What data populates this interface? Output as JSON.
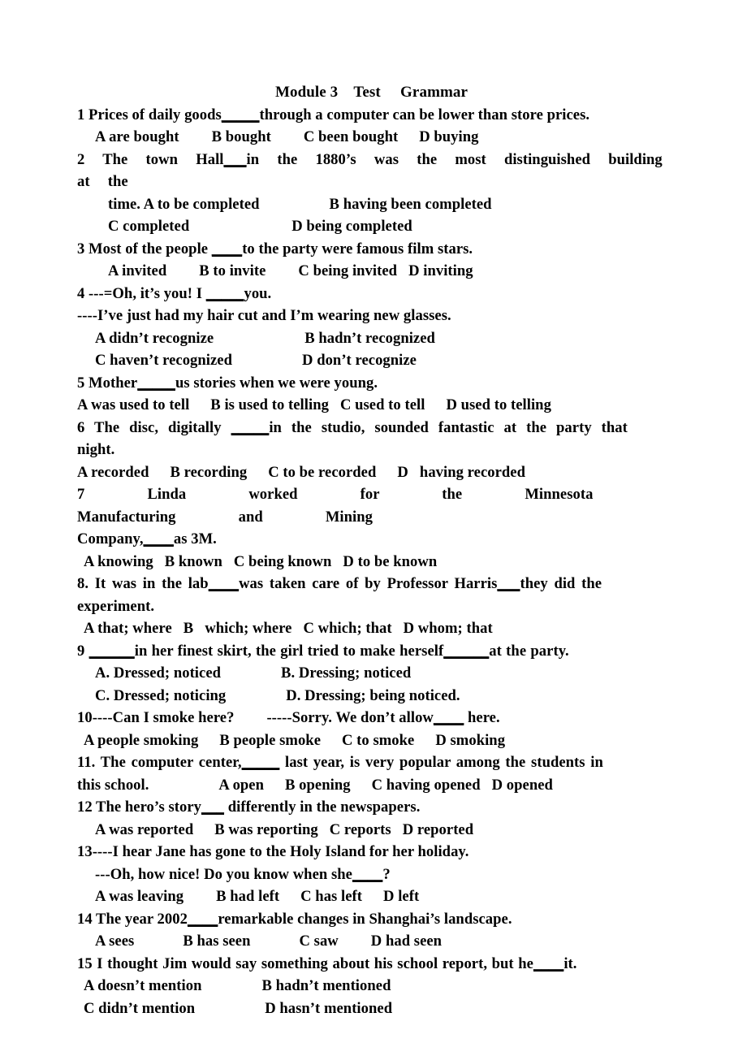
{
  "document": {
    "title": "Module 3    Test     Grammar",
    "questions": [
      {
        "number": "1",
        "stem_before": "1 Prices of daily goods",
        "blank": "_____",
        "stem_after": "through a computer can be lower than store prices.",
        "options_line": "A are bought",
        "option_b": "B bought",
        "option_c": "C been bought",
        "option_d": "D buying"
      },
      {
        "number": "2",
        "stem_line1_before": "2  The  town  Hall",
        "stem_line1_blank": "___",
        "stem_line1_after": "in  the  1880’s  was  the  most  distinguished  building  at  the",
        "stem_line2": "time. A to be completed",
        "option_b": "B having been completed",
        "option_c": "C completed",
        "option_d": "D being completed"
      },
      {
        "number": "3",
        "stem_before": "3 Most of the people ",
        "blank": "____",
        "stem_after": "to the party were famous film stars.",
        "option_a": "A invited",
        "option_b": "B to invite",
        "option_c": "C being invited",
        "option_d": "D inviting"
      },
      {
        "number": "4",
        "stem_line1_before": "4 ---=Oh, it’s you! I ",
        "stem_line1_blank": "_____",
        "stem_line1_after": "you.",
        "stem_line2": "----I’ve just had my hair cut and I’m wearing new glasses.",
        "option_a": "A didn’t recognize",
        "option_b": "B hadn’t recognized",
        "option_c": "C haven’t recognized",
        "option_d": "D don’t recognize"
      },
      {
        "number": "5",
        "stem_before": "5 Mother",
        "blank": "_____",
        "stem_after": "us stories when we were young.",
        "option_a": "A was used to tell",
        "option_b": "B is used to telling",
        "option_c": "C used to tell",
        "option_d": "D used to telling"
      },
      {
        "number": "6",
        "stem_line1_before": "6  The  disc,  digitally  ",
        "stem_line1_blank": "_____",
        "stem_line1_after": "in  the  studio,  sounded  fantastic  at  the  party  that",
        "stem_line2": "night.",
        "option_a": "A recorded",
        "option_b": "B recording",
        "option_c": "C to be recorded",
        "option_d": "D   having recorded"
      },
      {
        "number": "7",
        "stem_line1": "7   Linda   worked   for   the   Minnesota   Manufacturing   and   Mining",
        "stem_line2_before": "Company,",
        "stem_line2_blank": "____",
        "stem_line2_after": "as 3M.",
        "option_a": "A knowing",
        "option_b": "B known",
        "option_c": "C being known",
        "option_d": "D to be known"
      },
      {
        "number": "8",
        "stem_line1_before": "8. It was in the lab",
        "stem_line1_blank1": "____",
        "stem_line1_mid": "was taken care of by Professor Harris",
        "stem_line1_blank2": "___",
        "stem_line1_after": "they did the",
        "stem_line2": "experiment.",
        "option_a": "A that; where",
        "option_b": "B   which; where",
        "option_c": "C which; that",
        "option_d": "D whom; that"
      },
      {
        "number": "9",
        "stem_before": "9 ",
        "blank1": "______",
        "stem_mid": "in her finest skirt, the girl tried to make herself",
        "blank2": "______",
        "stem_after": "at the party.",
        "option_a": "A. Dressed; noticed",
        "option_b": "B. Dressing; noticed",
        "option_c": "C. Dressed; noticing",
        "option_d": "D. Dressing; being noticed."
      },
      {
        "number": "10",
        "stem_before": "10----Can I smoke here?",
        "stem_mid": "-----Sorry. We don’t allow",
        "blank": "____",
        "stem_after": " here.",
        "option_a": "A people smoking",
        "option_b": "B people smoke",
        "option_c": "C to smoke",
        "option_d": "D smoking"
      },
      {
        "number": "11",
        "stem_line1_before": "11. The computer center,",
        "stem_line1_blank": "_____",
        "stem_line1_after": " last year, is very popular among the students in",
        "stem_line2": "this school.",
        "option_a": "A open",
        "option_b": "B opening",
        "option_c": "C having opened",
        "option_d": "D opened"
      },
      {
        "number": "12",
        "stem_before": "12 The hero’s story",
        "blank": "___",
        "stem_after": " differently in the newspapers.",
        "option_a": "A was reported",
        "option_b": "B was reporting",
        "option_c": "C reports",
        "option_d": "D reported"
      },
      {
        "number": "13",
        "stem_line1": "13----I hear Jane has gone to the Holy Island for her holiday.",
        "stem_line2_before": "---Oh, how nice! Do you know when she",
        "stem_line2_blank": "____",
        "stem_line2_after": "?",
        "option_a": "A was leaving",
        "option_b": "B had left",
        "option_c": "C has left",
        "option_d": "D left"
      },
      {
        "number": "14",
        "stem_before": "14 The year 2002",
        "blank": "____",
        "stem_after": "remarkable changes in Shanghai’s landscape.",
        "option_a": "A sees",
        "option_b": "B has seen",
        "option_c": "C saw",
        "option_d": "D had seen"
      },
      {
        "number": "15",
        "stem_before": "15 I thought Jim would say something about his school report, but he",
        "blank": "____",
        "stem_after": "it.",
        "option_a": "A doesn’t mention",
        "option_b": "B hadn’t mentioned",
        "option_c": "C didn’t mention",
        "option_d": "D hasn’t mentioned"
      }
    ]
  }
}
